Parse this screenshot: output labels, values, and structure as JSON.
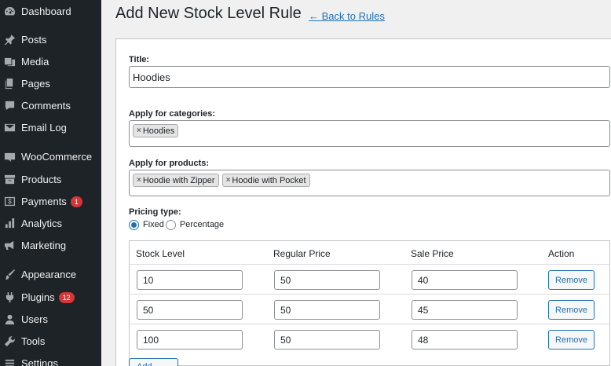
{
  "sidebar": {
    "items": [
      {
        "label": "Dashboard",
        "icon": "dashboard-icon"
      },
      {
        "label": "Posts",
        "icon": "pin-icon"
      },
      {
        "label": "Media",
        "icon": "media-icon"
      },
      {
        "label": "Pages",
        "icon": "pages-icon"
      },
      {
        "label": "Comments",
        "icon": "comment-icon"
      },
      {
        "label": "Email Log",
        "icon": "envelope-icon"
      },
      {
        "label": "WooCommerce",
        "icon": "woo-icon"
      },
      {
        "label": "Products",
        "icon": "archive-icon"
      },
      {
        "label": "Payments",
        "icon": "dollar-icon",
        "badge": "1"
      },
      {
        "label": "Analytics",
        "icon": "bar-chart-icon"
      },
      {
        "label": "Marketing",
        "icon": "megaphone-icon"
      },
      {
        "label": "Appearance",
        "icon": "paintbrush-icon"
      },
      {
        "label": "Plugins",
        "icon": "plugin-icon",
        "badge": "12"
      },
      {
        "label": "Users",
        "icon": "user-icon"
      },
      {
        "label": "Tools",
        "icon": "wrench-icon"
      },
      {
        "label": "Settings",
        "icon": "settings-icon"
      }
    ]
  },
  "header": {
    "title": "Add New Stock Level Rule",
    "back_link": "← Back to Rules"
  },
  "form": {
    "title_label": "Title:",
    "title_value": "Hoodies",
    "categories_label": "Apply for categories:",
    "categories": [
      "Hoodies"
    ],
    "products_label": "Apply for products:",
    "products": [
      "Hoodie with Zipper",
      "Hoodie with Pocket"
    ],
    "pricing_type_label": "Pricing type:",
    "pricing_options": [
      "Fixed",
      "Percentage"
    ],
    "pricing_selected": "Fixed",
    "chip_remove_glyph": "×"
  },
  "table": {
    "headers": [
      "Stock Level",
      "Regular Price",
      "Sale Price",
      "Action"
    ],
    "rows": [
      {
        "stock": "10",
        "regular": "50",
        "sale": "40",
        "action": "Remove"
      },
      {
        "stock": "50",
        "regular": "50",
        "sale": "45",
        "action": "Remove"
      },
      {
        "stock": "100",
        "regular": "50",
        "sale": "48",
        "action": "Remove"
      }
    ],
    "add_button": "Add Rule"
  },
  "colors": {
    "sidebar_bg": "#1d2327",
    "accent": "#2271b1",
    "badge": "#d63638"
  }
}
